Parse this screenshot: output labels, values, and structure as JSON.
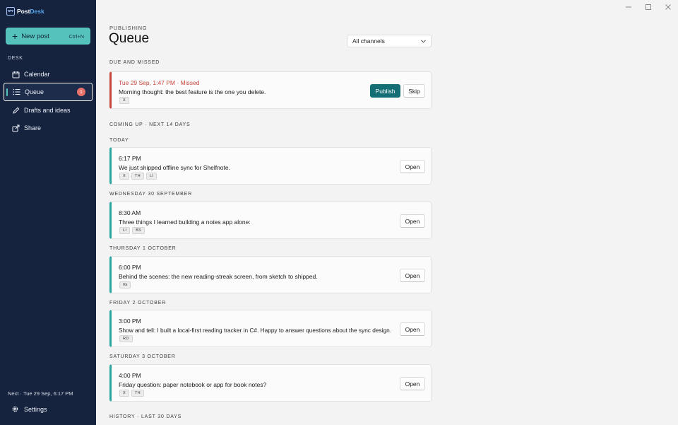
{
  "app": {
    "name_a": "Post",
    "name_b": "Desk"
  },
  "sidebar": {
    "new_post": {
      "label": "New post",
      "shortcut": "Ctrl+N"
    },
    "section": "DESK",
    "items": [
      {
        "label": "Calendar",
        "icon": "calendar-icon"
      },
      {
        "label": "Queue",
        "icon": "list-icon",
        "badge": "1",
        "active": true
      },
      {
        "label": "Drafts and ideas",
        "icon": "pencil-icon"
      },
      {
        "label": "Share",
        "icon": "share-icon"
      }
    ],
    "next_info": "Next · Tue 29 Sep, 6:17 PM",
    "settings": "Settings"
  },
  "header": {
    "eyebrow": "PUBLISHING",
    "title": "Queue",
    "channel": "All channels"
  },
  "groups": {
    "due": "DUE AND MISSED",
    "coming": "COMING UP · NEXT 14 DAYS",
    "today": "TODAY",
    "wed": "WEDNESDAY 30 SEPTEMBER",
    "thu": "THURSDAY 1 OCTOBER",
    "fri": "FRIDAY 2 OCTOBER",
    "sat": "SATURDAY 3 OCTOBER",
    "history": "HISTORY · LAST 30 DAYS"
  },
  "missed": {
    "time": "Tue 29 Sep, 1:47 PM · Missed",
    "text": "Morning thought: the best feature is the one you delete.",
    "tags": [
      "X"
    ],
    "publish": "Publish",
    "skip": "Skip"
  },
  "posts": [
    {
      "time": "6:17 PM",
      "text": "We just shipped offline sync for Shelfnote.",
      "tags": [
        "X",
        "TH",
        "LI"
      ],
      "action": "Open"
    },
    {
      "time": "8:30 AM",
      "text": "Three things I learned building a notes app alone:",
      "tags": [
        "LI",
        "BS"
      ],
      "action": "Open"
    },
    {
      "time": "6:00 PM",
      "text": "Behind the scenes: the new reading-streak screen, from sketch to shipped.",
      "tags": [
        "IG"
      ],
      "action": "Open"
    },
    {
      "time": "3:00 PM",
      "text": "Show and tell: I built a local-first reading tracker in C#. Happy to answer questions about the sync design.",
      "tags": [
        "RD"
      ],
      "action": "Open"
    },
    {
      "time": "4:00 PM",
      "text": "Friday question: paper notebook or app for book notes?",
      "tags": [
        "X",
        "TH"
      ],
      "action": "Open"
    }
  ],
  "colors": {
    "sidebar": "#16233f",
    "accent": "#56c2bc",
    "primary": "#136f73",
    "missed": "#c8453c",
    "badge": "#e8716a"
  }
}
